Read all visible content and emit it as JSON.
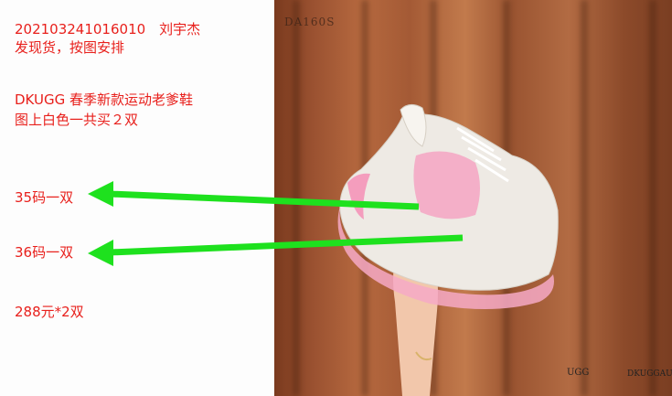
{
  "order": {
    "id_and_name": "202103241016010　刘宇杰",
    "instruction": "发现货，按图安排",
    "product": "DKUGG 春季新款运动老爹鞋",
    "note": "图上白色一共买２双",
    "size_1": "35码一双",
    "size_2": "36码一双",
    "price": "288元*2双"
  },
  "photo": {
    "watermark": "DA160S",
    "logo_ugg": "UGG",
    "logo_dkuggau": "DKUGGAU"
  },
  "colors": {
    "text": "#e8201c",
    "arrow": "#1ee11e",
    "curtain": "#a45a35"
  }
}
